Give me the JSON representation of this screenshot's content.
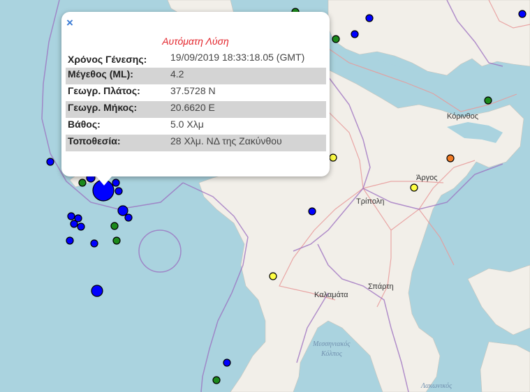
{
  "popup": {
    "close_symbol": "×",
    "title": "Αυτόματη Λύση",
    "rows": [
      {
        "label": "Χρόνος Γένεσης:",
        "value": "19/09/2019 18:33:18.05 (GMT)"
      },
      {
        "label": "Μέγεθος (ML):",
        "value": "4.2"
      },
      {
        "label": "Γεωγρ. Πλάτος:",
        "value": "37.5728 N"
      },
      {
        "label": "Γεωγρ. Μήκος:",
        "value": "20.6620 E"
      },
      {
        "label": "Βάθος:",
        "value": "5.0 Χλμ"
      },
      {
        "label": "Τοποθεσία:",
        "value": "28 Χλμ. ΝΔ της Ζακύνθου"
      }
    ]
  },
  "places": {
    "korinthos": "Κόρινθος",
    "argos": "Άργος",
    "tripoli": "Τρίπολη",
    "kalamata": "Καλαμάτα",
    "sparti": "Σπάρτη",
    "messiniakos": "Μεσσηνιακός",
    "kolpos": "Κόλπος",
    "lakonikos": "Λακωνικός"
  },
  "colors": {
    "sea": "#aad3df",
    "land": "#f2efe9",
    "quake_blue": "#0000ff",
    "quake_green": "#1c8a1c",
    "quake_yellow": "#ffff44",
    "quake_orange": "#f07a24",
    "popup_title": "#e3242b"
  }
}
